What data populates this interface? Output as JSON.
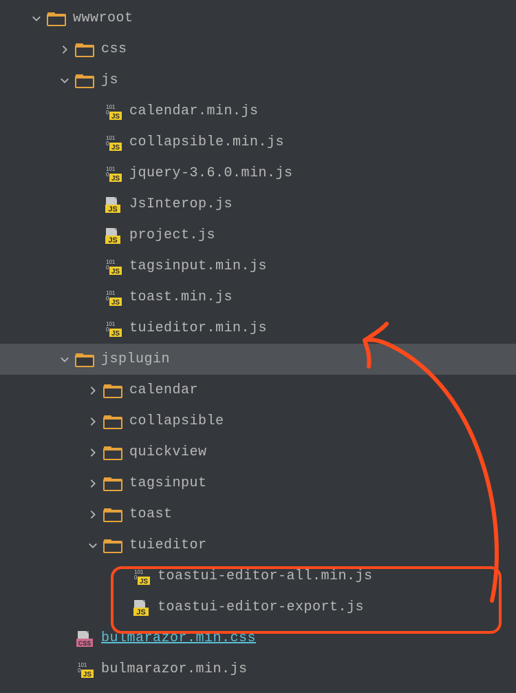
{
  "tree": {
    "indentStep": 41,
    "baseIndent": 44,
    "rows": [
      {
        "depth": 0,
        "arrow": "down",
        "icon": "folder",
        "label": "wwwroot"
      },
      {
        "depth": 1,
        "arrow": "right",
        "icon": "folder",
        "label": "css"
      },
      {
        "depth": 1,
        "arrow": "down",
        "icon": "folder",
        "label": "js"
      },
      {
        "depth": 2,
        "arrow": "none",
        "icon": "js-min",
        "label": "calendar.min.js"
      },
      {
        "depth": 2,
        "arrow": "none",
        "icon": "js-min",
        "label": "collapsible.min.js"
      },
      {
        "depth": 2,
        "arrow": "none",
        "icon": "js-min",
        "label": "jquery-3.6.0.min.js"
      },
      {
        "depth": 2,
        "arrow": "none",
        "icon": "js",
        "label": "JsInterop.js"
      },
      {
        "depth": 2,
        "arrow": "none",
        "icon": "js",
        "label": "project.js"
      },
      {
        "depth": 2,
        "arrow": "none",
        "icon": "js-min",
        "label": "tagsinput.min.js"
      },
      {
        "depth": 2,
        "arrow": "none",
        "icon": "js-min",
        "label": "toast.min.js"
      },
      {
        "depth": 2,
        "arrow": "none",
        "icon": "js-min",
        "label": "tuieditor.min.js"
      },
      {
        "depth": 1,
        "arrow": "down",
        "icon": "folder",
        "label": "jsplugin",
        "selected": true
      },
      {
        "depth": 2,
        "arrow": "right",
        "icon": "folder",
        "label": "calendar"
      },
      {
        "depth": 2,
        "arrow": "right",
        "icon": "folder",
        "label": "collapsible"
      },
      {
        "depth": 2,
        "arrow": "right",
        "icon": "folder",
        "label": "quickview"
      },
      {
        "depth": 2,
        "arrow": "right",
        "icon": "folder",
        "label": "tagsinput"
      },
      {
        "depth": 2,
        "arrow": "right",
        "icon": "folder",
        "label": "toast"
      },
      {
        "depth": 2,
        "arrow": "down",
        "icon": "folder",
        "label": "tuieditor"
      },
      {
        "depth": 3,
        "arrow": "none",
        "icon": "js-min",
        "label": "toastui-editor-all.min.js"
      },
      {
        "depth": 3,
        "arrow": "none",
        "icon": "js",
        "label": "toastui-editor-export.js"
      },
      {
        "depth": 1,
        "arrow": "none",
        "icon": "css",
        "label": "bulmarazor.min.css",
        "blue": true
      },
      {
        "depth": 1,
        "arrow": "none",
        "icon": "js-min",
        "label": "bulmarazor.min.js"
      }
    ]
  },
  "annotation": {
    "arrowColor": "#ff4a1c"
  }
}
